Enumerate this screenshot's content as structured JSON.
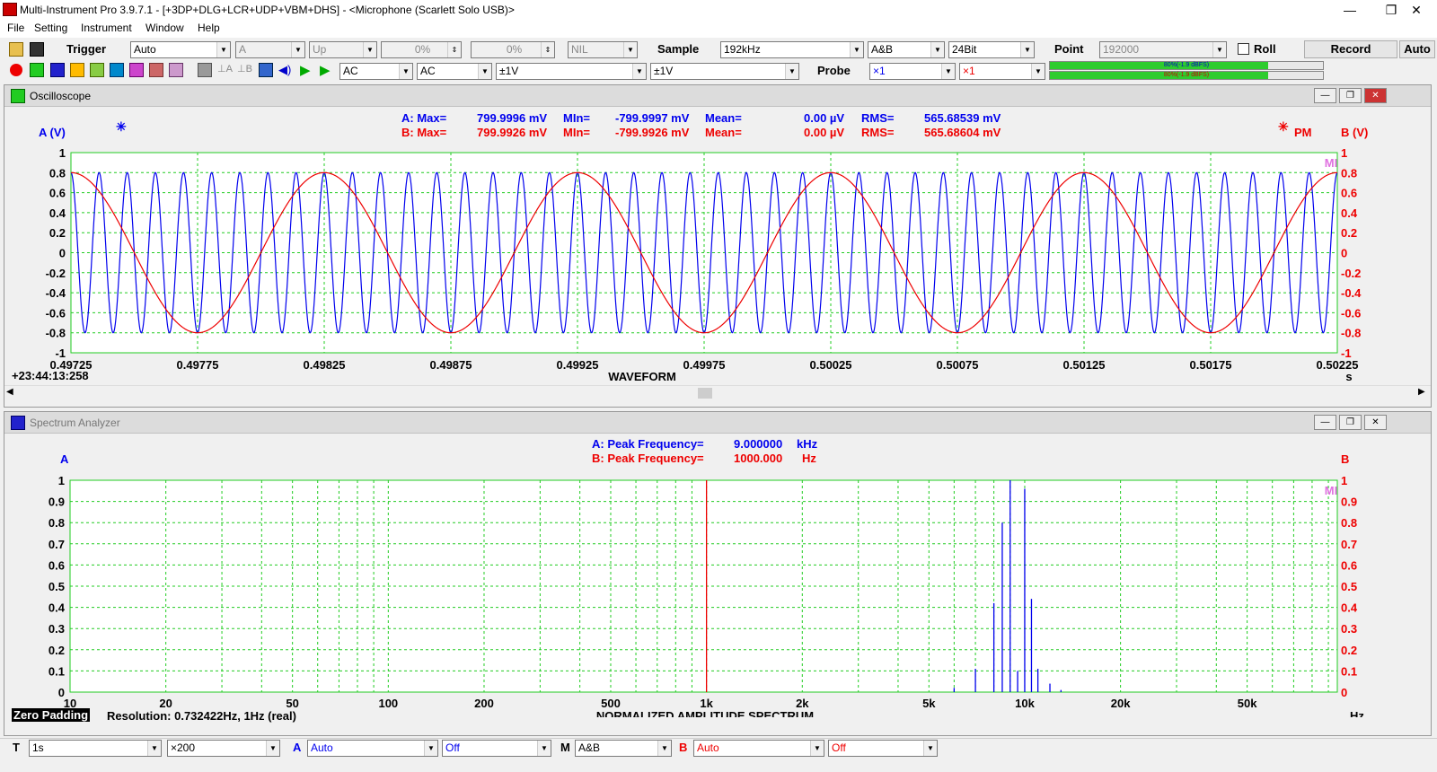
{
  "app": {
    "title": "Multi-Instrument Pro 3.9.7.1   -   [+3DP+DLG+LCR+UDP+VBM+DHS]   -   <Microphone (Scarlett Solo USB)>"
  },
  "window_buttons": {
    "minimize": "—",
    "restore": "❐",
    "close": "✕"
  },
  "menu": [
    "File",
    "Setting",
    "Instrument",
    "Window",
    "Help"
  ],
  "toolbar1": {
    "trigger_label": "Trigger",
    "trigger_mode": "Auto",
    "trigger_source": "A",
    "trigger_edge": "Up",
    "trigger_level": "0%",
    "trigger_delay": "0%",
    "trigger_extra": "NIL",
    "sample_label": "Sample",
    "sample_rate": "192kHz",
    "channels": "A&B",
    "bit_depth": "24Bit",
    "point_label": "Point",
    "points": "192000",
    "roll_label": "Roll",
    "record_label": "Record",
    "auto_label": "Auto"
  },
  "toolbar2": {
    "coupling_a": "AC",
    "coupling_b": "AC",
    "range_a": "±1V",
    "range_b": "±1V",
    "probe_label": "Probe",
    "probe_a": "×1",
    "probe_b": "×1",
    "level_a": "80%(-1.9 dBFS)",
    "level_b": "80%(-1.9 dBFS)",
    "level_a_fraction": 0.8,
    "level_b_fraction": 0.8
  },
  "oscilloscope": {
    "title": "Oscilloscope",
    "a_stats": {
      "max_label": "A: Max=",
      "max": "799.9996 mV",
      "min_label": "MIn=",
      "min": "-799.9997 mV",
      "mean_label": "Mean=",
      "mean": "0.00  µV",
      "rms_label": "RMS=",
      "rms": "565.68539 mV"
    },
    "b_stats": {
      "max_label": "B: Max=",
      "max": "799.9926 mV",
      "min_label": "MIn=",
      "min": "-799.9926 mV",
      "mean_label": "Mean=",
      "mean": "0.00  µV",
      "rms_label": "RMS=",
      "rms": "565.68604 mV"
    },
    "y_left_label": "A (V)",
    "y_right_label": "B (V)",
    "pm_label": "PM",
    "mi_mark": "MI",
    "timestamp": "+23:44:13:258",
    "x_title": "WAVEFORM",
    "x_unit": "s",
    "y_ticks": [
      "1",
      "0.8",
      "0.6",
      "0.4",
      "0.2",
      "0",
      "-0.2",
      "-0.4",
      "-0.6",
      "-0.8",
      "-1"
    ],
    "x_ticks": [
      "0.49725",
      "0.49775",
      "0.49825",
      "0.49875",
      "0.49925",
      "0.49975",
      "0.50025",
      "0.50075",
      "0.50125",
      "0.50175",
      "0.50225"
    ]
  },
  "spectrum": {
    "title": "Spectrum Analyzer",
    "a_peak_label": "A: Peak Frequency=",
    "a_peak": "9.000000",
    "a_peak_unit": "kHz",
    "b_peak_label": "B: Peak Frequency=",
    "b_peak": "1000.000",
    "b_peak_unit": "Hz",
    "y_left_label": "A",
    "y_right_label": "B",
    "mi_mark": "MI",
    "zero_padding": "Zero Padding",
    "resolution": "Resolution: 0.732422Hz, 1Hz (real)",
    "x_title": "NORMALIZED AMPLITUDE SPECTRUM",
    "x_unit": "Hz",
    "y_ticks": [
      "1",
      "0.9",
      "0.8",
      "0.7",
      "0.6",
      "0.5",
      "0.4",
      "0.3",
      "0.2",
      "0.1",
      "0"
    ],
    "x_ticks": [
      "10",
      "20",
      "50",
      "100",
      "200",
      "500",
      "1k",
      "2k",
      "5k",
      "10k",
      "20k",
      "50k"
    ]
  },
  "statusbar": {
    "t_label": "T",
    "t_value": "1s",
    "zoom": "×200",
    "a_label": "A",
    "a_value": "Auto",
    "a_off": "Off",
    "m_label": "M",
    "m_value": "A&B",
    "b_label": "B",
    "b_value": "Auto",
    "b_off": "Off"
  },
  "colors": {
    "channel_a": "#0000ee",
    "channel_b": "#ee0000",
    "grid": "#22cc22"
  },
  "chart_data": [
    {
      "type": "line",
      "title": "WAVEFORM",
      "xlabel": "s",
      "ylabel": "A (V)",
      "y2label": "B (V)",
      "xlim": [
        0.49725,
        0.50225
      ],
      "ylim": [
        -1,
        1
      ],
      "grid": true,
      "series": [
        {
          "name": "A",
          "kind": "sine",
          "frequency_hz": 9000,
          "amplitude": 0.8
        },
        {
          "name": "B",
          "kind": "sine",
          "frequency_hz": 1000,
          "amplitude": 0.8
        }
      ]
    },
    {
      "type": "bar",
      "title": "NORMALIZED AMPLITUDE SPECTRUM",
      "xlabel": "Hz",
      "xscale": "log",
      "xlim": [
        10,
        96000
      ],
      "ylim": [
        0,
        1
      ],
      "grid": true,
      "series": [
        {
          "name": "A",
          "x": [
            6000,
            7000,
            8000,
            8500,
            9000,
            9500,
            10000,
            10500,
            11000,
            12000,
            13000
          ],
          "y": [
            0.02,
            0.11,
            0.42,
            0.8,
            1.0,
            0.1,
            0.96,
            0.44,
            0.11,
            0.04,
            0.01
          ]
        },
        {
          "name": "B",
          "x": [
            1000
          ],
          "y": [
            1.0
          ]
        }
      ]
    }
  ]
}
